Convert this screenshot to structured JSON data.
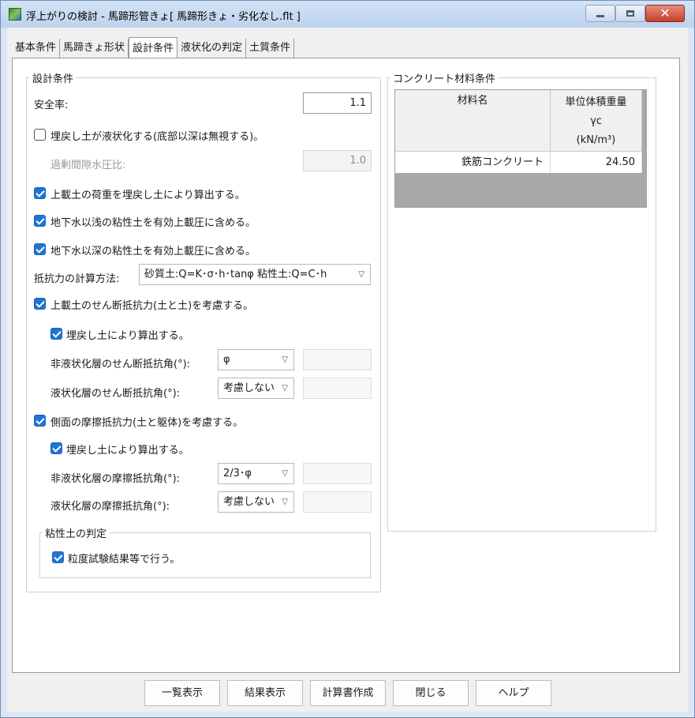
{
  "window": {
    "title": "浮上がりの検討 - 馬蹄形管きょ[ 馬蹄形きょ・劣化なし.flt ]",
    "close_symbol": "✕"
  },
  "tabs": [
    {
      "label": "基本条件"
    },
    {
      "label": "馬蹄きょ形状"
    },
    {
      "label": "設計条件"
    },
    {
      "label": "液状化の判定"
    },
    {
      "label": "土質条件"
    }
  ],
  "design": {
    "group_title": "設計条件",
    "safety_factor_label": "安全率:",
    "safety_factor_value": "1.1",
    "backfill_liquefy_label": "埋戻し土が液状化する(底部以深は無視する)。",
    "backfill_liquefy_checked": false,
    "excess_pore_label": "過剰間隙水圧比:",
    "excess_pore_value": "1.0",
    "overburden_label": "上載土の荷重を埋戻し土により算出する。",
    "shallow_clay_label": "地下水以浅の粘性土を有効上載圧に含める。",
    "deep_clay_label": "地下水以深の粘性土を有効上載圧に含める。",
    "resistance_method_label": "抵抗力の計算方法:",
    "resistance_method_value": "砂質土:Q=K･σ･h･tanφ  粘性土:Q=C･h",
    "shear_label": "上載土のせん断抵抗力(土と土)を考慮する。",
    "shear_backfill_label": "埋戻し土により算出する。",
    "shear_nonliq_label": "非液状化層のせん断抵抗角(°):",
    "shear_nonliq_value": "φ",
    "shear_liq_label": "液状化層のせん断抵抗角(°):",
    "shear_liq_value": "考慮しない",
    "friction_label": "側面の摩擦抵抗力(土と躯体)を考慮する。",
    "friction_backfill_label": "埋戻し土により算出する。",
    "friction_nonliq_label": "非液状化層の摩擦抵抗角(°):",
    "friction_nonliq_value": "2/3･φ",
    "friction_liq_label": "液状化層の摩擦抵抗角(°):",
    "friction_liq_value": "考慮しない",
    "clay_group_title": "粘性土の判定",
    "clay_grain_label": "粒度試験結果等で行う。"
  },
  "concrete": {
    "group_title": "コンクリート材料条件",
    "col_material": "材料名",
    "col_weight_line1": "単位体積重量",
    "col_weight_line2": "γc",
    "col_weight_line3": "(kN/m³)",
    "row_material": "鉄筋コンクリート",
    "row_weight": "24.50"
  },
  "buttons": {
    "list": "一覧表示",
    "result": "結果表示",
    "report": "計算書作成",
    "close": "閉じる",
    "help": "ヘルプ"
  },
  "colors": {
    "accent_check": "#1f74d6",
    "close_button": "#c3402a"
  }
}
